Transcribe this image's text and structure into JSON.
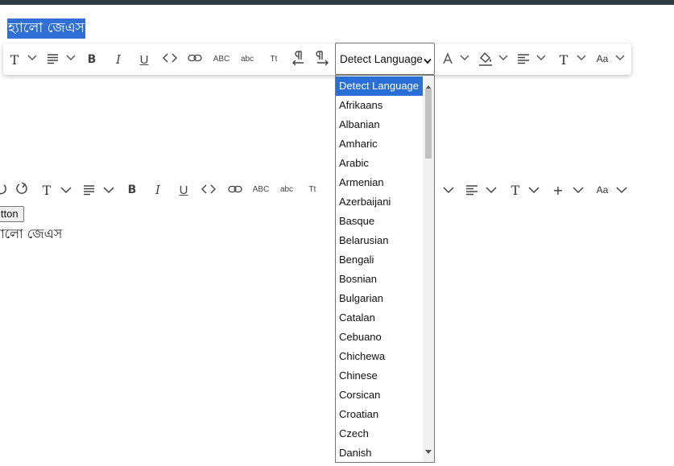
{
  "editor": {
    "selected_text": "হ্যালো জেএস",
    "plain_text": "হ্যালো জেএস",
    "button_label": "Button"
  },
  "toolbar": {
    "font_label": "T",
    "bold_label": "B",
    "italic_label": "I",
    "underline_label": "U",
    "code_label": "<>",
    "uppercase_label": "ABC",
    "lowercase_label": "abc",
    "titlecase_label": "Tt",
    "textcolor_label": "A",
    "fontsize_label": "T",
    "case_label": "Aa",
    "language_selected": "Detect Language"
  },
  "toolbar2": {
    "font_label": "T",
    "bold_label": "B",
    "italic_label": "I",
    "underline_label": "U",
    "code_label": "<>",
    "uppercase_label": "ABC",
    "lowercase_label": "abc",
    "titlecase_label": "Tt",
    "fontsize_label": "T",
    "plus_label": "+",
    "case_label": "Aa"
  },
  "language_options": [
    "Detect Language",
    "Afrikaans",
    "Albanian",
    "Amharic",
    "Arabic",
    "Armenian",
    "Azerbaijani",
    "Basque",
    "Belarusian",
    "Bengali",
    "Bosnian",
    "Bulgarian",
    "Catalan",
    "Cebuano",
    "Chichewa",
    "Chinese",
    "Corsican",
    "Croatian",
    "Czech",
    "Danish"
  ],
  "colors": {
    "selection": "#2f6fd6",
    "option_highlight": "#2a6fd6",
    "topbar": "#2f3b3d"
  }
}
